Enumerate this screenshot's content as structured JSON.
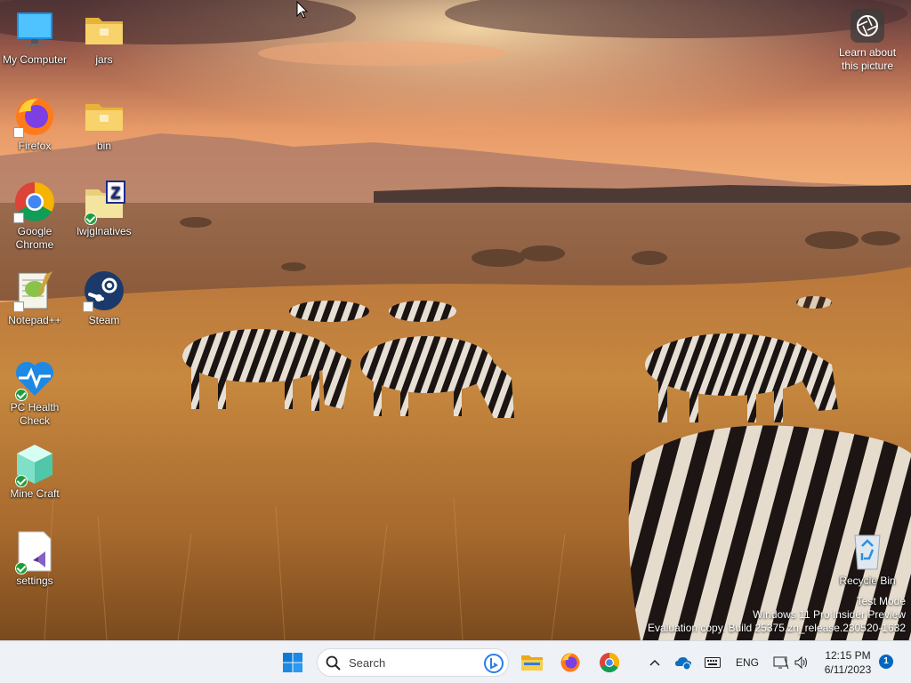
{
  "desktop": {
    "icons": [
      {
        "label": "My Computer"
      },
      {
        "label": "jars"
      },
      {
        "label": "Firefox"
      },
      {
        "label": "bin"
      },
      {
        "label": "Google Chrome"
      },
      {
        "label": "lwjglnatives"
      },
      {
        "label": "Notepad++"
      },
      {
        "label": "Steam"
      },
      {
        "label": "PC Health Check"
      },
      {
        "label": "Mine Craft"
      },
      {
        "label": "settings"
      },
      {
        "label": "Recycle Bin"
      }
    ],
    "learn_about": "Learn about this picture",
    "watermark": {
      "line1": "Test Mode",
      "line2": "Windows 11 Pro Insider Preview",
      "line3": "Evaluation copy. Build 25375.zn_release.230520-1632"
    }
  },
  "taskbar": {
    "search_placeholder": "Search",
    "language": "ENG",
    "time": "12:15 PM",
    "date": "6/11/2023",
    "notification_count": "1",
    "accent": "#0067c0"
  }
}
